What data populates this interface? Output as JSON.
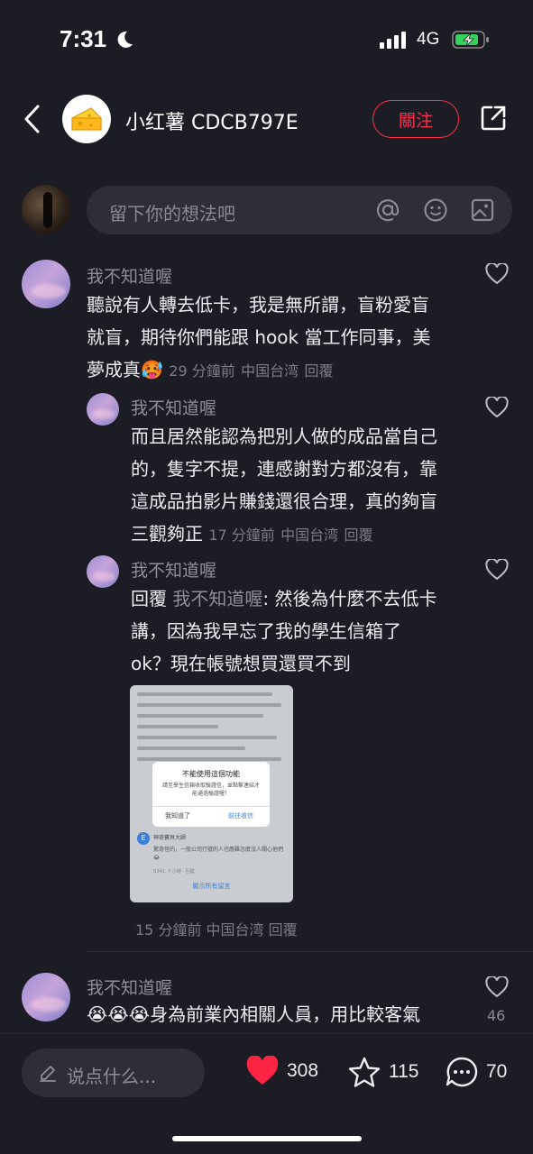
{
  "status_bar": {
    "time": "7:31",
    "network": "4G"
  },
  "header": {
    "name": "小红薯 CDCB797E",
    "follow_label": "關注"
  },
  "comment_input": {
    "placeholder": "留下你的想法吧"
  },
  "comments": [
    {
      "name": "我不知道喔",
      "text_lines": [
        "聽說有人轉去低卡，我是無所謂，盲粉愛盲",
        "就盲，期待你們能跟 hook 當工作同事，美"
      ],
      "last_line": "夢成真",
      "emoji": "🥵",
      "time": "29 分鐘前",
      "location": "中国台湾",
      "reply_label": "回覆"
    },
    {
      "name": "我不知道喔",
      "text_lines": [
        "而且居然能認為把別人做的成品當自己",
        "的，隻字不提，連感謝對方都沒有，靠",
        "這成品拍影片賺錢還很合理，真的夠盲"
      ],
      "last_line": "三觀夠正",
      "time": "17 分鐘前",
      "location": "中国台湾",
      "reply_label": "回覆"
    },
    {
      "name": "我不知道喔",
      "reply_prefix": "回覆",
      "reply_to": "我不知道喔",
      "first_line_rest": ": 然後為什麼不去低卡",
      "text_lines": [
        "講，因為我早忘了我的學生信箱了",
        "ok？現在帳號想買還買不到"
      ],
      "time": "15 分鐘前",
      "location": "中国台湾",
      "reply_label": "回覆",
      "screenshot": {
        "dialog_title": "不能使用這個功能",
        "dialog_text": "請至學生信箱收取驗證信，並點擊連結才能通過驗證喔！",
        "btn_ok": "我知道了",
        "btn_go": "前往收信",
        "reply_badge": "E",
        "reply_name": "神奇寶貝大師",
        "reply_text": "驚奇怪的，一般公司行號的人也應難怎麼沒人關心他們😂",
        "reply_meta": "B341. 7 小時 · 回覆",
        "view_all": "顯示所有留言"
      }
    },
    {
      "name": "我不知道喔",
      "emoji": "😭😭😭",
      "text": "身為前業內相關人員，用比較客氣",
      "like_count": "46"
    }
  ],
  "bottom_bar": {
    "say_placeholder": "说点什么...",
    "likes": "308",
    "stars": "115",
    "comments": "70",
    "like_color": "#ff2442"
  }
}
